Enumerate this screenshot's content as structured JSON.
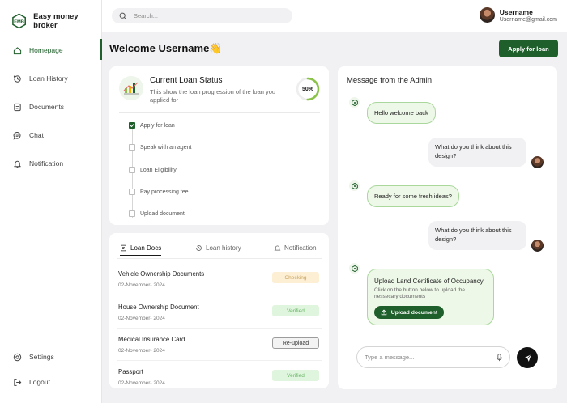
{
  "brand": {
    "name": "Easy money broker"
  },
  "sidebar": {
    "items": [
      {
        "label": "Homepage",
        "icon": "home-icon"
      },
      {
        "label": "Loan History",
        "icon": "history-icon"
      },
      {
        "label": "Documents",
        "icon": "document-icon"
      },
      {
        "label": "Chat",
        "icon": "chat-icon"
      },
      {
        "label": "Notification",
        "icon": "bell-icon"
      }
    ],
    "settings_label": "Settings",
    "logout_label": "Logout"
  },
  "search": {
    "placeholder": "Search..."
  },
  "user": {
    "name": "Username",
    "email": "Username@gmail.com"
  },
  "header": {
    "welcome": "Welcome Username👋",
    "apply_label": "Apply for loan"
  },
  "loan_status": {
    "title": "Current Loan Status",
    "description": "This show the loan progression of the loan you applied for",
    "progress_label": "50%",
    "progress_value": 0.5,
    "steps": [
      {
        "label": "Apply for loan",
        "done": true
      },
      {
        "label": "Speak with an agent",
        "done": false
      },
      {
        "label": "Loan Eligibility",
        "done": false
      },
      {
        "label": "Pay processing fee",
        "done": false
      },
      {
        "label": "Upload document",
        "done": false
      }
    ]
  },
  "docs": {
    "tabs": [
      "Loan Docs",
      "Loan history",
      "Notification"
    ],
    "rows": [
      {
        "name": "Vehicle Ownership Documents",
        "date": "02-November- 2024",
        "status": "Checking"
      },
      {
        "name": "House Ownership Document",
        "date": "02-November- 2024",
        "status": "Verified"
      },
      {
        "name": "Medical Insurance Card",
        "date": "02-November- 2024",
        "status": "Re-upload"
      },
      {
        "name": "Passport",
        "date": "02-November- 2024",
        "status": "Verified"
      }
    ]
  },
  "messages": {
    "title": "Message from the Admin",
    "items": [
      {
        "from": "admin",
        "text": "Hello welcome back"
      },
      {
        "from": "user",
        "text": "What do you think about this design?"
      },
      {
        "from": "admin",
        "text": "Ready for some fresh ideas?"
      },
      {
        "from": "user",
        "text": "What do you think about this design?"
      }
    ],
    "upload": {
      "title": "Upload Land Certificate of Occupancy",
      "description": "Click on the button below to upload the nessecary documents",
      "button_label": "Upload document"
    },
    "input_placeholder": "Type a message..."
  },
  "colors": {
    "primary": "#1f5f2b",
    "accent_green": "#8bc34a",
    "bubble_border": "#a9d79c"
  }
}
